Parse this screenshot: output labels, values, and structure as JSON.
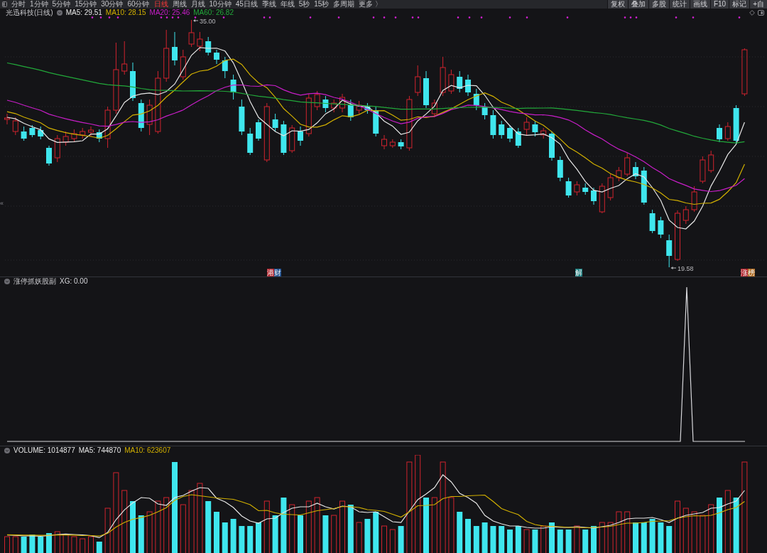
{
  "toolbar": {
    "periods": [
      {
        "label": "分时",
        "selected": false
      },
      {
        "label": "1分钟",
        "selected": false
      },
      {
        "label": "5分钟",
        "selected": false
      },
      {
        "label": "15分钟",
        "selected": false
      },
      {
        "label": "30分钟",
        "selected": false
      },
      {
        "label": "60分钟",
        "selected": false
      },
      {
        "label": "日线",
        "selected": true
      },
      {
        "label": "周线",
        "selected": false
      },
      {
        "label": "月线",
        "selected": false
      },
      {
        "label": "10分钟",
        "selected": false
      },
      {
        "label": "45日线",
        "selected": false
      },
      {
        "label": "季线",
        "selected": false
      },
      {
        "label": "年线",
        "selected": false
      },
      {
        "label": "5秒",
        "selected": false
      },
      {
        "label": "15秒",
        "selected": false
      },
      {
        "label": "多周期",
        "selected": false
      },
      {
        "label": "更多 〉",
        "selected": false
      }
    ],
    "tools": [
      "复权",
      "叠加",
      "多股",
      "统计",
      "画线",
      "F10",
      "标记",
      "+自"
    ]
  },
  "side_handle": {
    "label": "«"
  },
  "price_panel": {
    "title": "光迅科技(日线)",
    "indicators": [
      {
        "label": "MA5: 29.51",
        "color": "#e6e6e6"
      },
      {
        "label": "MA10: 28.15",
        "color": "#d2b000"
      },
      {
        "label": "MA20: 25.46",
        "color": "#c81ec8"
      },
      {
        "label": "MA60: 26.82",
        "color": "#22a83a"
      }
    ],
    "high_label": "35.00",
    "low_label": "19.58",
    "event_tags": [
      {
        "label": "港",
        "color": "#b3222b"
      },
      {
        "label": "财",
        "color": "#1e4f8f"
      },
      {
        "label": "解",
        "color": "#1c7f80"
      },
      {
        "label": "涨",
        "color": "#b3222b"
      },
      {
        "label": "榜",
        "color": "#b06a1e"
      }
    ]
  },
  "signal_panel": {
    "title": "涨停抓妖股副",
    "reading": "XG: 0.00"
  },
  "volume_panel": {
    "indicators": [
      {
        "label": "VOLUME: 1014877",
        "color": "#e6e6e6"
      },
      {
        "label": "MA5: 744870",
        "color": "#e6e6e6"
      },
      {
        "label": "MA10: 623607",
        "color": "#d2b000"
      }
    ]
  }
}
